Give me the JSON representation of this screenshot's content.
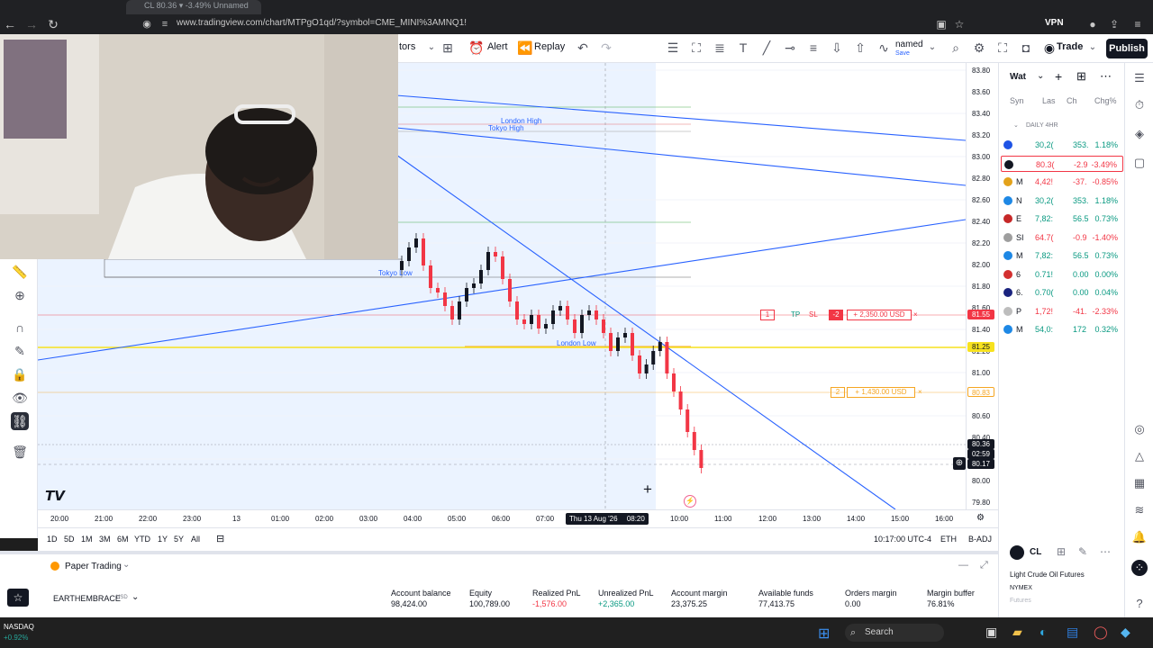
{
  "browser": {
    "tab_title": "CL 80.36 ▾ -3.49% Unnamed",
    "url": "www.tradingview.com/chart/MTPgO1qd/?symbol=CME_MINI%3AMNQ1!",
    "vpn_label": "VPN"
  },
  "toolbar": {
    "indicators_label": "tors",
    "alert_label": "Alert",
    "replay_label": "Replay",
    "layout_name": "named",
    "layout_sub": "Save",
    "trade_label": "Trade",
    "publish_label": "Publish"
  },
  "chart": {
    "time_labels": [
      "20:00",
      "21:00",
      "22:00",
      "23:00",
      "13",
      "01:00",
      "02:00",
      "03:00",
      "04:00",
      "05:00",
      "06:00",
      "07:00",
      "10:00",
      "11:00",
      "12:00",
      "13:00",
      "14:00",
      "15:00",
      "16:00"
    ],
    "crosshair_date": "Thu 13 Aug '26",
    "crosshair_time": "08:20",
    "price_labels": [
      "83.80",
      "83.60",
      "83.40",
      "83.20",
      "83.00",
      "82.80",
      "82.60",
      "82.40",
      "82.20",
      "82.00",
      "81.80",
      "81.60",
      "81.40",
      "81.20",
      "81.00",
      "80.80",
      "80.60",
      "80.40",
      "80.20",
      "80.00",
      "79.80"
    ],
    "annotations": {
      "london_high": "London High",
      "tokyo_high": "Tokyo High",
      "tokyo_low": "Tokyo Low",
      "london_low": "London Low"
    },
    "tp_order": {
      "qty": "1",
      "tp": "TP",
      "sl": "SL",
      "count": "-2",
      "pnl": "+ 2,350.00 USD",
      "close": "×"
    },
    "entry_order": {
      "qty": "2",
      "pnl": "+ 1,430.00 USD",
      "close": "×"
    },
    "price_badges": {
      "tp": "81.55",
      "yellow": "81.25",
      "entry": "80.83",
      "last": "80.36",
      "countdown": "02:59",
      "bid": "80.17"
    },
    "colors": {
      "tp": "#f23645",
      "yellow": "#f7e21f",
      "entry": "#f5a623",
      "line": "#2962ff"
    }
  },
  "range": {
    "items": [
      "1D",
      "5D",
      "1M",
      "3M",
      "6M",
      "YTD",
      "1Y",
      "5Y",
      "All"
    ],
    "time": "10:17:00 UTC-4",
    "session": "ETH",
    "adj": "B-ADJ"
  },
  "bottom": {
    "tab_label": "Paper Trading",
    "account_name": "EARTHEMBRACE",
    "account_ccy": "USD",
    "stats": [
      {
        "label": "Account balance",
        "value": "98,424.00",
        "color": "#131722"
      },
      {
        "label": "Equity",
        "value": "100,789.00",
        "color": "#131722"
      },
      {
        "label": "Realized PnL",
        "value": "-1,576.00",
        "color": "#f23645"
      },
      {
        "label": "Unrealized PnL",
        "value": "+2,365.00",
        "color": "#089981"
      },
      {
        "label": "Account margin",
        "value": "23,375.25",
        "color": "#131722"
      },
      {
        "label": "Available funds",
        "value": "77,413.75",
        "color": "#131722"
      },
      {
        "label": "Orders margin",
        "value": "0.00",
        "color": "#131722"
      },
      {
        "label": "Margin buffer",
        "value": "76.81%",
        "color": "#131722"
      }
    ]
  },
  "watchlist": {
    "title": "Wat",
    "columns": [
      "Syn",
      "Las",
      "Ch",
      "Chg%"
    ],
    "section": "DAILY 4HR",
    "rows": [
      {
        "sym": "",
        "last": "30,2(",
        "chg": "353.",
        "pct": "1.18%",
        "dir": "up",
        "icon": "#1e53e5"
      },
      {
        "sym": "",
        "last": "80.3(",
        "chg": "-2.9",
        "pct": "-3.49%",
        "dir": "down",
        "icon": "#131722"
      },
      {
        "sym": "M",
        "last": "4,42!",
        "chg": "-37.",
        "pct": "-0.85%",
        "dir": "down",
        "icon": "#e3a21a"
      },
      {
        "sym": "N",
        "last": "30,2(",
        "chg": "353.",
        "pct": "1.18%",
        "dir": "up",
        "icon": "#1e88e5"
      },
      {
        "sym": "E",
        "last": "7,82:",
        "chg": "56.5",
        "pct": "0.73%",
        "dir": "up",
        "icon": "#c62828"
      },
      {
        "sym": "SI",
        "last": "64.7(",
        "chg": "-0.9",
        "pct": "-1.40%",
        "dir": "down",
        "icon": "#9e9e9e"
      },
      {
        "sym": "M",
        "last": "7,82:",
        "chg": "56.5",
        "pct": "0.73%",
        "dir": "up",
        "icon": "#1e88e5"
      },
      {
        "sym": "6",
        "last": "0.71!",
        "chg": "0.00",
        "pct": "0.00%",
        "dir": "up",
        "icon": "#d32f2f"
      },
      {
        "sym": "6.",
        "last": "0.70(",
        "chg": "0.00",
        "pct": "0.04%",
        "dir": "up",
        "icon": "#1a237e"
      },
      {
        "sym": "P",
        "last": "1,72!",
        "chg": "-41.",
        "pct": "-2.33%",
        "dir": "down",
        "icon": "#bdbdbd"
      },
      {
        "sym": "M",
        "last": "54,0:",
        "chg": "172",
        "pct": "0.32%",
        "dir": "up",
        "icon": "#1e88e5"
      }
    ],
    "detail_symbol": "CL",
    "detail_name": "Light Crude Oil Futures",
    "detail_exchange": "NYMEX",
    "detail_type": "Futures"
  },
  "taskbar": {
    "ticker_name": "NASDAQ",
    "ticker_change": "+0.92%",
    "search_label": "Search"
  }
}
